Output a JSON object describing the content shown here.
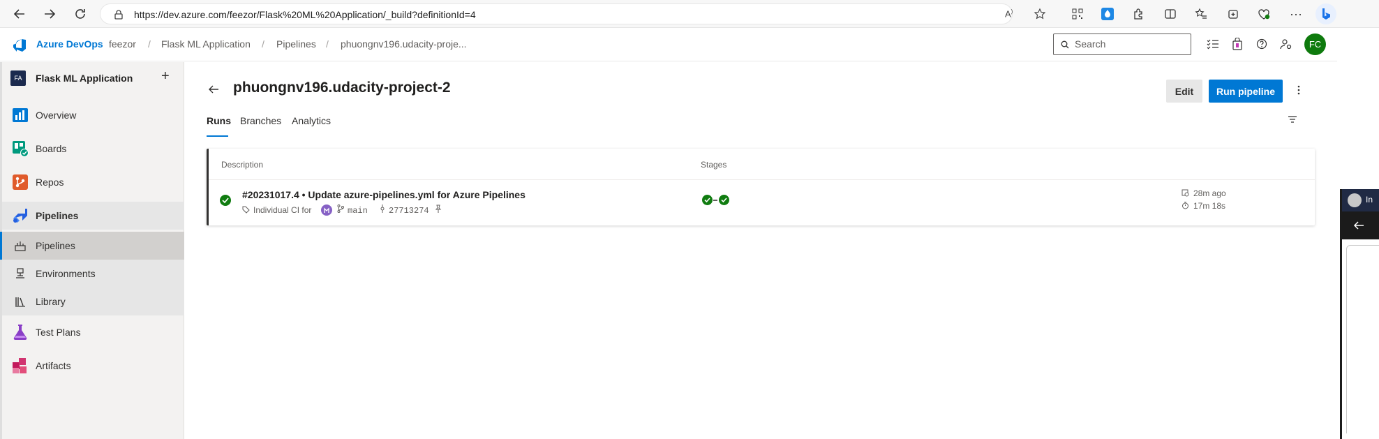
{
  "browser": {
    "url": "https://dev.azure.com/feezor/Flask%20ML%20Application/_build?definitionId=4"
  },
  "header": {
    "brand": "Azure DevOps",
    "breadcrumbs": [
      "feezor",
      "Flask ML Application",
      "Pipelines",
      "phuongnv196.udacity-proje..."
    ],
    "search_placeholder": "Search",
    "avatar_initials": "FC"
  },
  "sidebar": {
    "project_badge": "FA",
    "project_name": "Flask ML Application",
    "add_symbol": "+",
    "items": [
      {
        "label": "Overview"
      },
      {
        "label": "Boards"
      },
      {
        "label": "Repos"
      },
      {
        "label": "Pipelines"
      }
    ],
    "sub_items": [
      {
        "label": "Pipelines"
      },
      {
        "label": "Environments"
      },
      {
        "label": "Library"
      }
    ],
    "bottom_items": [
      {
        "label": "Test Plans"
      },
      {
        "label": "Artifacts"
      }
    ]
  },
  "main": {
    "title": "phuongnv196.udacity-project-2",
    "edit_label": "Edit",
    "run_label": "Run pipeline",
    "tabs": [
      {
        "label": "Runs",
        "active": true
      },
      {
        "label": "Branches",
        "active": false
      },
      {
        "label": "Analytics",
        "active": false
      }
    ],
    "table": {
      "headers": {
        "description": "Description",
        "stages": "Stages"
      },
      "runs": [
        {
          "title": "#20231017.4 • Update azure-pipelines.yml for Azure Pipelines",
          "trigger": "Individual CI for",
          "branch": "main",
          "commit": "27713274",
          "time_ago": "28m ago",
          "duration": "17m 18s",
          "status": "succeeded",
          "stages": [
            "succeeded",
            "succeeded"
          ]
        }
      ]
    }
  },
  "popup": {
    "label": "In"
  },
  "colors": {
    "accent": "#0078d4",
    "success": "#107c10",
    "avatar": "#0e7a0d"
  }
}
